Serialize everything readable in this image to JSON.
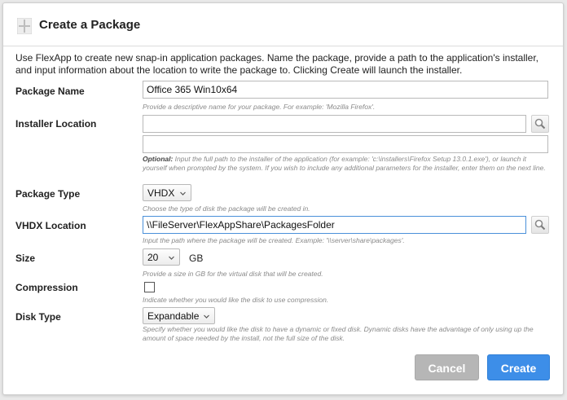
{
  "dialog": {
    "title": "Create a Package",
    "intro": "Use FlexApp to create new snap-in application packages. Name the package, provide a path to the application's installer, and input information about the location to write the package to. Clicking Create will launch the installer."
  },
  "fields": {
    "package_name": {
      "label": "Package Name",
      "value": "Office 365 Win10x64",
      "hint": "Provide a descriptive name for your package. For example: 'Mozilla Firefox'."
    },
    "installer_location": {
      "label": "Installer Location",
      "value": "",
      "params_value": "",
      "hint_prefix": "Optional:",
      "hint": " Input the full path to the installer of the application (for example: 'c:\\installers\\Firefox Setup 13.0.1.exe'), or launch it yourself when prompted by the system. If you wish to include any additional parameters for the installer, enter them on the next line."
    },
    "package_type": {
      "label": "Package Type",
      "value": "VHDX",
      "hint": "Choose the type of disk the package will be created in."
    },
    "vhdx_location": {
      "label": "VHDX Location",
      "value": "\\\\FileServer\\FlexAppShare\\PackagesFolder",
      "hint": "Input the path where the package will be created. Example: '\\\\server\\share\\packages'."
    },
    "size": {
      "label": "Size",
      "value": "20",
      "unit": "GB",
      "hint": "Provide a size in GB for the virtual disk that will be created."
    },
    "compression": {
      "label": "Compression",
      "checked": false,
      "hint": "Indicate whether you would like the disk to use compression."
    },
    "disk_type": {
      "label": "Disk Type",
      "value": "Expandable",
      "hint": "Specify whether you would like the disk to have a dynamic or fixed disk. Dynamic disks have the advantage of only using up the amount of space needed by the install, not the full size of the disk."
    }
  },
  "buttons": {
    "cancel": "Cancel",
    "create": "Create"
  },
  "colors": {
    "accent": "#3d8ee8",
    "cancel": "#b6b6b6"
  }
}
